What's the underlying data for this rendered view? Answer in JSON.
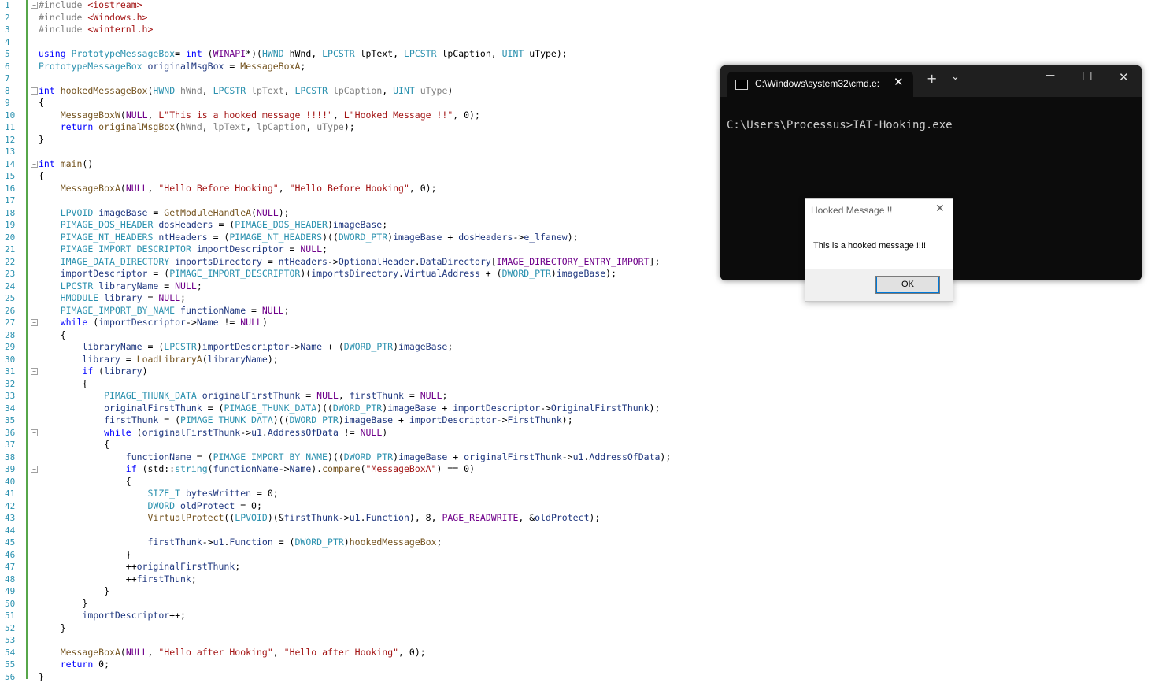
{
  "editor": {
    "lines": [
      [
        [
          "pp",
          "#include "
        ],
        [
          "inc",
          "<iostream>"
        ]
      ],
      [
        [
          "pp",
          "#include "
        ],
        [
          "inc",
          "<Windows.h>"
        ]
      ],
      [
        [
          "pp",
          "#include "
        ],
        [
          "inc",
          "<winternl.h>"
        ]
      ],
      [],
      [
        [
          "kw",
          "using "
        ],
        [
          "ty",
          "PrototypeMessageBox"
        ],
        [
          "",
          "= "
        ],
        [
          "kw",
          "int "
        ],
        [
          "",
          "("
        ],
        [
          "mc",
          "WINAPI"
        ],
        [
          "",
          "*)("
        ],
        [
          "ty",
          "HWND "
        ],
        [
          "",
          "hWnd, "
        ],
        [
          "ty",
          "LPCSTR "
        ],
        [
          "",
          "lpText, "
        ],
        [
          "ty",
          "LPCSTR "
        ],
        [
          "",
          "lpCaption, "
        ],
        [
          "ty",
          "UINT "
        ],
        [
          "",
          "uType);"
        ]
      ],
      [
        [
          "ty",
          "PrototypeMessageBox "
        ],
        [
          "vr",
          "originalMsgBox "
        ],
        [
          "",
          "= "
        ],
        [
          "fn",
          "MessageBoxA"
        ],
        [
          ";",
          ";"
        ]
      ],
      [],
      [
        [
          "kw",
          "int "
        ],
        [
          "fn",
          "hookedMessageBox"
        ],
        [
          "",
          "("
        ],
        [
          "ty",
          "HWND "
        ],
        [
          "pm",
          "hWnd"
        ],
        [
          ", ",
          ", "
        ],
        [
          "ty",
          "LPCSTR "
        ],
        [
          "pm",
          "lpText"
        ],
        [
          ", ",
          ", "
        ],
        [
          "ty",
          "LPCSTR "
        ],
        [
          "pm",
          "lpCaption"
        ],
        [
          ", ",
          ", "
        ],
        [
          "ty",
          "UINT "
        ],
        [
          "pm",
          "uType"
        ],
        [
          "",
          ")"
        ]
      ],
      [
        [
          "",
          "{"
        ]
      ],
      [
        [
          "",
          "    "
        ],
        [
          "fn",
          "MessageBoxW"
        ],
        [
          "",
          "("
        ],
        [
          "mc",
          "NULL"
        ],
        [
          "",
          ", "
        ],
        [
          "str",
          "L\"This is a hooked message !!!!\""
        ],
        [
          "",
          ", "
        ],
        [
          "str",
          "L\"Hooked Message !!\""
        ],
        [
          "",
          ", 0);"
        ]
      ],
      [
        [
          "",
          "    "
        ],
        [
          "kw",
          "return "
        ],
        [
          "fn",
          "originalMsgBox"
        ],
        [
          "",
          "("
        ],
        [
          "pm",
          "hWnd"
        ],
        [
          "",
          ", "
        ],
        [
          "pm",
          "lpText"
        ],
        [
          "",
          ", "
        ],
        [
          "pm",
          "lpCaption"
        ],
        [
          "",
          ", "
        ],
        [
          "pm",
          "uType"
        ],
        [
          "",
          ");"
        ]
      ],
      [
        [
          "",
          "}"
        ]
      ],
      [],
      [
        [
          "kw",
          "int "
        ],
        [
          "fn",
          "main"
        ],
        [
          "",
          "()"
        ]
      ],
      [
        [
          "",
          "{"
        ]
      ],
      [
        [
          "",
          "    "
        ],
        [
          "fn",
          "MessageBoxA"
        ],
        [
          "",
          "("
        ],
        [
          "mc",
          "NULL"
        ],
        [
          "",
          ", "
        ],
        [
          "str",
          "\"Hello Before Hooking\""
        ],
        [
          "",
          ", "
        ],
        [
          "str",
          "\"Hello Before Hooking\""
        ],
        [
          "",
          ", 0);"
        ]
      ],
      [],
      [
        [
          "",
          "    "
        ],
        [
          "ty",
          "LPVOID "
        ],
        [
          "vr",
          "imageBase "
        ],
        [
          "",
          "= "
        ],
        [
          "fn",
          "GetModuleHandleA"
        ],
        [
          "",
          "("
        ],
        [
          "mc",
          "NULL"
        ],
        [
          "",
          ");"
        ]
      ],
      [
        [
          "",
          "    "
        ],
        [
          "ty",
          "PIMAGE_DOS_HEADER "
        ],
        [
          "vr",
          "dosHeaders "
        ],
        [
          "",
          "= ("
        ],
        [
          "ty",
          "PIMAGE_DOS_HEADER"
        ],
        [
          "",
          ")"
        ],
        [
          "vr",
          "imageBase"
        ],
        [
          "",
          ";"
        ]
      ],
      [
        [
          "",
          "    "
        ],
        [
          "ty",
          "PIMAGE_NT_HEADERS "
        ],
        [
          "vr",
          "ntHeaders "
        ],
        [
          "",
          "= ("
        ],
        [
          "ty",
          "PIMAGE_NT_HEADERS"
        ],
        [
          "",
          ")(("
        ],
        [
          "ty",
          "DWORD_PTR"
        ],
        [
          "",
          ")"
        ],
        [
          "vr",
          "imageBase "
        ],
        [
          "",
          "+ "
        ],
        [
          "vr",
          "dosHeaders"
        ],
        [
          "",
          "->"
        ],
        [
          "mb",
          "e_lfanew"
        ],
        [
          "",
          ");"
        ]
      ],
      [
        [
          "",
          "    "
        ],
        [
          "ty",
          "PIMAGE_IMPORT_DESCRIPTOR "
        ],
        [
          "vr",
          "importDescriptor "
        ],
        [
          "",
          "= "
        ],
        [
          "mc",
          "NULL"
        ],
        [
          "",
          ";"
        ]
      ],
      [
        [
          "",
          "    "
        ],
        [
          "ty",
          "IMAGE_DATA_DIRECTORY "
        ],
        [
          "vr",
          "importsDirectory "
        ],
        [
          "",
          "= "
        ],
        [
          "vr",
          "ntHeaders"
        ],
        [
          "",
          "->"
        ],
        [
          "mb",
          "OptionalHeader"
        ],
        [
          "",
          "."
        ],
        [
          "mb",
          "DataDirectory"
        ],
        [
          "",
          "["
        ],
        [
          "mc",
          "IMAGE_DIRECTORY_ENTRY_IMPORT"
        ],
        [
          "",
          "];"
        ]
      ],
      [
        [
          "",
          "    "
        ],
        [
          "vr",
          "importDescriptor "
        ],
        [
          "",
          "= ("
        ],
        [
          "ty",
          "PIMAGE_IMPORT_DESCRIPTOR"
        ],
        [
          "",
          ")("
        ],
        [
          "vr",
          "importsDirectory"
        ],
        [
          "",
          "."
        ],
        [
          "mb",
          "VirtualAddress "
        ],
        [
          "",
          "+ ("
        ],
        [
          "ty",
          "DWORD_PTR"
        ],
        [
          "",
          ")"
        ],
        [
          "vr",
          "imageBase"
        ],
        [
          "",
          ");"
        ]
      ],
      [
        [
          "",
          "    "
        ],
        [
          "ty",
          "LPCSTR "
        ],
        [
          "vr",
          "libraryName "
        ],
        [
          "",
          "= "
        ],
        [
          "mc",
          "NULL"
        ],
        [
          "",
          ";"
        ]
      ],
      [
        [
          "",
          "    "
        ],
        [
          "ty",
          "HMODULE "
        ],
        [
          "vr",
          "library "
        ],
        [
          "",
          "= "
        ],
        [
          "mc",
          "NULL"
        ],
        [
          "",
          ";"
        ]
      ],
      [
        [
          "",
          "    "
        ],
        [
          "ty",
          "PIMAGE_IMPORT_BY_NAME "
        ],
        [
          "vr",
          "functionName "
        ],
        [
          "",
          "= "
        ],
        [
          "mc",
          "NULL"
        ],
        [
          "",
          ";"
        ]
      ],
      [
        [
          "",
          "    "
        ],
        [
          "kw",
          "while "
        ],
        [
          "",
          "("
        ],
        [
          "vr",
          "importDescriptor"
        ],
        [
          "",
          "->"
        ],
        [
          "mb",
          "Name "
        ],
        [
          "",
          "!= "
        ],
        [
          "mc",
          "NULL"
        ],
        [
          "",
          ")"
        ]
      ],
      [
        [
          "",
          "    {"
        ]
      ],
      [
        [
          "",
          "        "
        ],
        [
          "vr",
          "libraryName "
        ],
        [
          "",
          "= ("
        ],
        [
          "ty",
          "LPCSTR"
        ],
        [
          "",
          ")"
        ],
        [
          "vr",
          "importDescriptor"
        ],
        [
          "",
          "->"
        ],
        [
          "mb",
          "Name "
        ],
        [
          "",
          "+ ("
        ],
        [
          "ty",
          "DWORD_PTR"
        ],
        [
          "",
          ")"
        ],
        [
          "vr",
          "imageBase"
        ],
        [
          "",
          ";"
        ]
      ],
      [
        [
          "",
          "        "
        ],
        [
          "vr",
          "library "
        ],
        [
          "",
          "= "
        ],
        [
          "fn",
          "LoadLibraryA"
        ],
        [
          "",
          "("
        ],
        [
          "vr",
          "libraryName"
        ],
        [
          "",
          ");"
        ]
      ],
      [
        [
          "",
          "        "
        ],
        [
          "kw",
          "if "
        ],
        [
          "",
          "("
        ],
        [
          "vr",
          "library"
        ],
        [
          "",
          ")"
        ]
      ],
      [
        [
          "",
          "        {"
        ]
      ],
      [
        [
          "",
          "            "
        ],
        [
          "ty",
          "PIMAGE_THUNK_DATA "
        ],
        [
          "vr",
          "originalFirstThunk "
        ],
        [
          "",
          "= "
        ],
        [
          "mc",
          "NULL"
        ],
        [
          "",
          ", "
        ],
        [
          "vr",
          "firstThunk "
        ],
        [
          "",
          "= "
        ],
        [
          "mc",
          "NULL"
        ],
        [
          "",
          ";"
        ]
      ],
      [
        [
          "",
          "            "
        ],
        [
          "vr",
          "originalFirstThunk "
        ],
        [
          "",
          "= ("
        ],
        [
          "ty",
          "PIMAGE_THUNK_DATA"
        ],
        [
          "",
          ")(("
        ],
        [
          "ty",
          "DWORD_PTR"
        ],
        [
          "",
          ")"
        ],
        [
          "vr",
          "imageBase "
        ],
        [
          "",
          "+ "
        ],
        [
          "vr",
          "importDescriptor"
        ],
        [
          "",
          "->"
        ],
        [
          "mb",
          "OriginalFirstThunk"
        ],
        [
          "",
          ");"
        ]
      ],
      [
        [
          "",
          "            "
        ],
        [
          "vr",
          "firstThunk "
        ],
        [
          "",
          "= ("
        ],
        [
          "ty",
          "PIMAGE_THUNK_DATA"
        ],
        [
          "",
          ")(("
        ],
        [
          "ty",
          "DWORD_PTR"
        ],
        [
          "",
          ")"
        ],
        [
          "vr",
          "imageBase "
        ],
        [
          "",
          "+ "
        ],
        [
          "vr",
          "importDescriptor"
        ],
        [
          "",
          "->"
        ],
        [
          "mb",
          "FirstThunk"
        ],
        [
          "",
          ");"
        ]
      ],
      [
        [
          "",
          "            "
        ],
        [
          "kw",
          "while "
        ],
        [
          "",
          "("
        ],
        [
          "vr",
          "originalFirstThunk"
        ],
        [
          "",
          "->"
        ],
        [
          "mb",
          "u1"
        ],
        [
          "",
          "."
        ],
        [
          "mb",
          "AddressOfData "
        ],
        [
          "",
          "!= "
        ],
        [
          "mc",
          "NULL"
        ],
        [
          "",
          ")"
        ]
      ],
      [
        [
          "",
          "            {"
        ]
      ],
      [
        [
          "",
          "                "
        ],
        [
          "vr",
          "functionName "
        ],
        [
          "",
          "= ("
        ],
        [
          "ty",
          "PIMAGE_IMPORT_BY_NAME"
        ],
        [
          "",
          ")(("
        ],
        [
          "ty",
          "DWORD_PTR"
        ],
        [
          "",
          ")"
        ],
        [
          "vr",
          "imageBase "
        ],
        [
          "",
          "+ "
        ],
        [
          "vr",
          "originalFirstThunk"
        ],
        [
          "",
          "->"
        ],
        [
          "mb",
          "u1"
        ],
        [
          "",
          "."
        ],
        [
          "mb",
          "AddressOfData"
        ],
        [
          "",
          ");"
        ]
      ],
      [
        [
          "",
          "                "
        ],
        [
          "kw",
          "if "
        ],
        [
          "",
          "(std::"
        ],
        [
          "ty",
          "string"
        ],
        [
          "",
          "("
        ],
        [
          "vr",
          "functionName"
        ],
        [
          "",
          "->"
        ],
        [
          "mb",
          "Name"
        ],
        [
          "",
          ")."
        ],
        [
          "fn",
          "compare"
        ],
        [
          "",
          "("
        ],
        [
          "str",
          "\"MessageBoxA\""
        ],
        [
          "",
          ") == 0)"
        ]
      ],
      [
        [
          "",
          "                {"
        ]
      ],
      [
        [
          "",
          "                    "
        ],
        [
          "ty",
          "SIZE_T "
        ],
        [
          "vr",
          "bytesWritten "
        ],
        [
          "",
          "= 0;"
        ]
      ],
      [
        [
          "",
          "                    "
        ],
        [
          "ty",
          "DWORD "
        ],
        [
          "vr",
          "oldProtect "
        ],
        [
          "",
          "= 0;"
        ]
      ],
      [
        [
          "",
          "                    "
        ],
        [
          "fn",
          "VirtualProtect"
        ],
        [
          "",
          "(("
        ],
        [
          "ty",
          "LPVOID"
        ],
        [
          "",
          ")(&"
        ],
        [
          "vr",
          "firstThunk"
        ],
        [
          "",
          "->"
        ],
        [
          "mb",
          "u1"
        ],
        [
          "",
          "."
        ],
        [
          "mb",
          "Function"
        ],
        [
          "",
          "), 8, "
        ],
        [
          "mc",
          "PAGE_READWRITE"
        ],
        [
          "",
          ", &"
        ],
        [
          "vr",
          "oldProtect"
        ],
        [
          "",
          ");"
        ]
      ],
      [],
      [
        [
          "",
          "                    "
        ],
        [
          "vr",
          "firstThunk"
        ],
        [
          "",
          "->"
        ],
        [
          "mb",
          "u1"
        ],
        [
          "",
          "."
        ],
        [
          "mb",
          "Function "
        ],
        [
          "",
          "= ("
        ],
        [
          "ty",
          "DWORD_PTR"
        ],
        [
          "",
          ")"
        ],
        [
          "fn",
          "hookedMessageBox"
        ],
        [
          "",
          ";"
        ]
      ],
      [
        [
          "",
          "                }"
        ]
      ],
      [
        [
          "",
          "                ++"
        ],
        [
          "vr",
          "originalFirstThunk"
        ],
        [
          "",
          ";"
        ]
      ],
      [
        [
          "",
          "                ++"
        ],
        [
          "vr",
          "firstThunk"
        ],
        [
          "",
          ";"
        ]
      ],
      [
        [
          "",
          "            }"
        ]
      ],
      [
        [
          "",
          "        }"
        ]
      ],
      [
        [
          "",
          "        "
        ],
        [
          "vr",
          "importDescriptor"
        ],
        [
          "",
          "++;"
        ]
      ],
      [
        [
          "",
          "    }"
        ]
      ],
      [],
      [
        [
          "",
          "    "
        ],
        [
          "fn",
          "MessageBoxA"
        ],
        [
          "",
          "("
        ],
        [
          "mc",
          "NULL"
        ],
        [
          "",
          ", "
        ],
        [
          "str",
          "\"Hello after Hooking\""
        ],
        [
          "",
          ", "
        ],
        [
          "str",
          "\"Hello after Hooking\""
        ],
        [
          "",
          ", 0);"
        ]
      ],
      [
        [
          "",
          "    "
        ],
        [
          "kw",
          "return "
        ],
        [
          "",
          "0;"
        ]
      ],
      [
        [
          "",
          "}"
        ]
      ]
    ],
    "fold_lines": [
      1,
      8,
      14,
      27,
      31,
      36,
      39
    ]
  },
  "console": {
    "tab_title": "C:\\Windows\\system32\\cmd.e:",
    "tab_close": "✕",
    "new_tab": "+",
    "dropdown": "⌄",
    "minimize": "—",
    "maximize": "☐",
    "close": "✕",
    "output": "C:\\Users\\Processus>IAT-Hooking.exe"
  },
  "dialog": {
    "title": "Hooked Message !!",
    "close": "✕",
    "message": "This is a hooked message !!!!",
    "ok_label": "OK"
  }
}
